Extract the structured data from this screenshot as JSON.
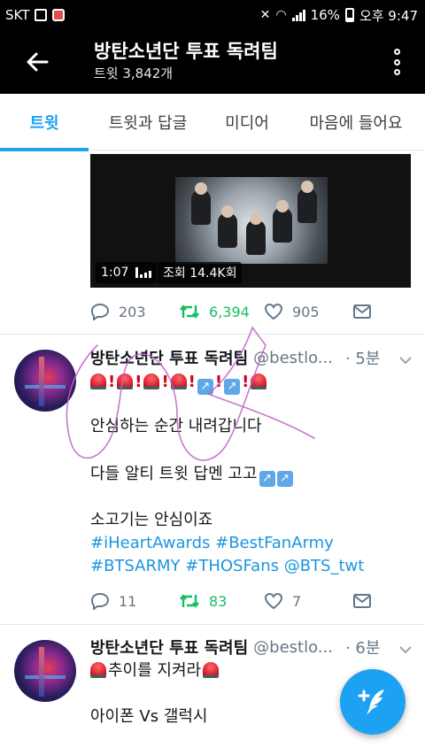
{
  "status_bar": {
    "carrier": "SKT",
    "battery": "16%",
    "time": "오후 9:47"
  },
  "header": {
    "title": "방탄소년단 투표 독려팀",
    "subtitle": "트윗 3,842개"
  },
  "tabs": [
    {
      "label": "트윗",
      "active": true
    },
    {
      "label": "트윗과 답글",
      "active": false
    },
    {
      "label": "미디어",
      "active": false
    },
    {
      "label": "마음에 들어요",
      "active": false
    }
  ],
  "tweets": [
    {
      "video": {
        "duration": "1:07",
        "views": "조회 14.4K회"
      },
      "replies": "203",
      "retweets": "6,394",
      "likes": "905"
    },
    {
      "name": "방탄소년단 투표 독려팀",
      "handle": "@bestlo...",
      "time": "· 5분",
      "emoji_line": "🚨!🚨!🚨!🚨!↗️!↗️!🚨",
      "lines": [
        "안심하는 순간 내려갑니다",
        "다들 알티 트윗 답멘 고고",
        "소고기는 안심이죠"
      ],
      "hashtags": [
        "#iHeartAwards #BestFanArmy",
        "#BTSARMY #THOSFans @BTS_twt"
      ],
      "replies": "11",
      "retweets": "83",
      "likes": "7"
    },
    {
      "name": "방탄소년단 투표 독려팀",
      "handle": "@bestlo...",
      "time": "· 6분",
      "lines": [
        "추이를 지켜라",
        "아이폰 Vs 갤럭시"
      ]
    }
  ],
  "colors": {
    "accent": "#1da1f2",
    "retweet": "#17bf63",
    "hashtag": "#1b95e0",
    "muted": "#657786"
  },
  "icons": [
    "back-arrow-icon",
    "more-vertical-icon",
    "reply-icon",
    "retweet-icon",
    "like-icon",
    "share-icon",
    "chevron-down-icon",
    "compose-icon"
  ]
}
